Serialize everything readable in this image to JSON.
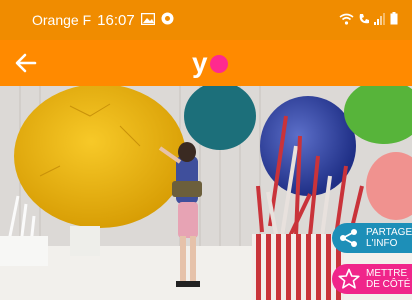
{
  "status_bar": {
    "carrier": "Orange F",
    "time": "16:07",
    "icons": [
      "gallery-icon",
      "chrome-icon",
      "wifi-icon",
      "call-icon",
      "signal-icon",
      "battery-icon"
    ]
  },
  "app_bar": {
    "back_icon": "arrow-left-icon",
    "logo_text": "y",
    "colors": {
      "bar": "#ff8a00",
      "logo_dot": "#ff2a8f"
    }
  },
  "actions": {
    "share": {
      "line1": "PARTAGER",
      "line2": "L'INFO",
      "icon": "share-icon",
      "color": "#1d8fb8"
    },
    "save": {
      "line1": "METTRE",
      "line2": "DE CÔTÉ",
      "icon": "star-icon",
      "color": "#f0258a"
    }
  }
}
